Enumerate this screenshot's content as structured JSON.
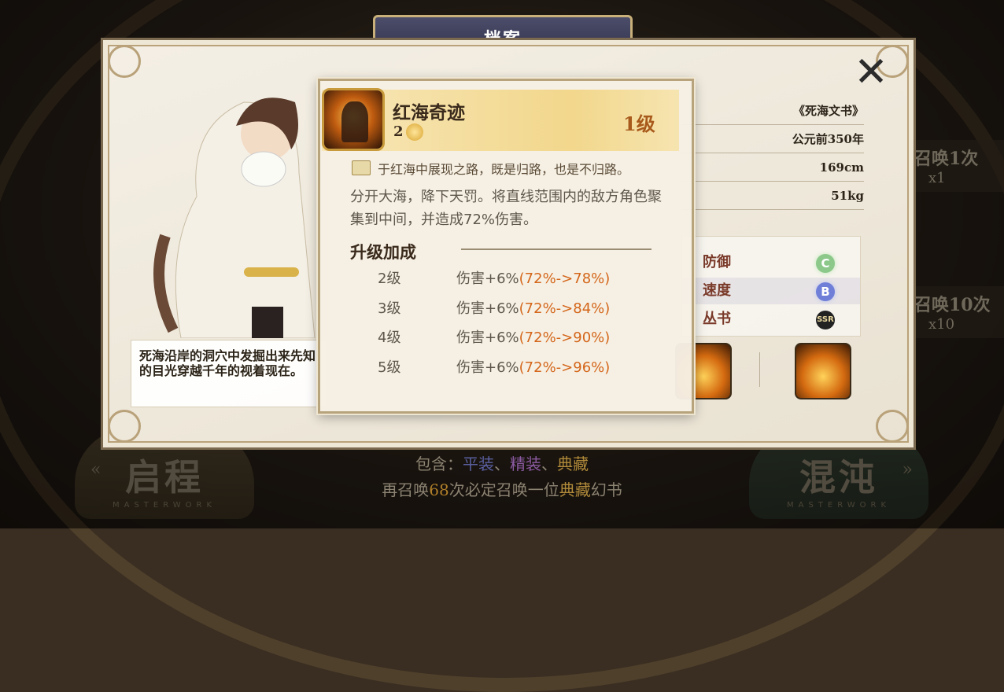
{
  "header": {
    "title": "档案"
  },
  "background": {
    "buttons": [
      {
        "label": "启程",
        "sub": "MASTERWORK"
      },
      {
        "label": "混沌",
        "sub": "MASTERWORK"
      }
    ],
    "info_prefix": "包含：",
    "info_types": [
      "平装",
      "精装",
      "典藏"
    ],
    "info_sep": "、",
    "pity_text_a": "再召唤",
    "pity_count": "68",
    "pity_text_b": "次必定召唤一位",
    "pity_rarity": "典藏",
    "pity_text_c": "幻书",
    "summon_once": {
      "label": "召唤1次",
      "cost": "x1"
    },
    "summon_ten": {
      "label": "召唤10次",
      "cost": "x10"
    }
  },
  "profile": {
    "caption": "死海沿岸的洞穴中发掘出来先知的目光穿越千年的视着现在。",
    "info_rows": [
      "《死海文书》",
      "公元前350年",
      "169cm",
      "51kg"
    ],
    "stats": [
      {
        "label": "防御",
        "grade": "C"
      },
      {
        "label": "速度",
        "grade": "B"
      },
      {
        "label": "丛书",
        "grade": "SSR"
      }
    ]
  },
  "popup": {
    "name": "红海奇迹",
    "cost": "2",
    "level": "1级",
    "quote": "于红海中展现之路，既是归路，也是不归路。",
    "description": "分开大海，降下天罚。将直线范围内的敌方角色聚集到中间，并造成72%伤害。",
    "upgrade_title": "升级加成",
    "upgrades": [
      {
        "level": "2级",
        "text": "伤害+6%",
        "change": "(72%->78%)"
      },
      {
        "level": "3级",
        "text": "伤害+6%",
        "change": "(72%->84%)"
      },
      {
        "level": "4级",
        "text": "伤害+6%",
        "change": "(72%->90%)"
      },
      {
        "level": "5级",
        "text": "伤害+6%",
        "change": "(72%->96%)"
      }
    ]
  },
  "icons": {
    "close": "close-icon",
    "book": "book-icon",
    "cost": "coin-icon"
  }
}
